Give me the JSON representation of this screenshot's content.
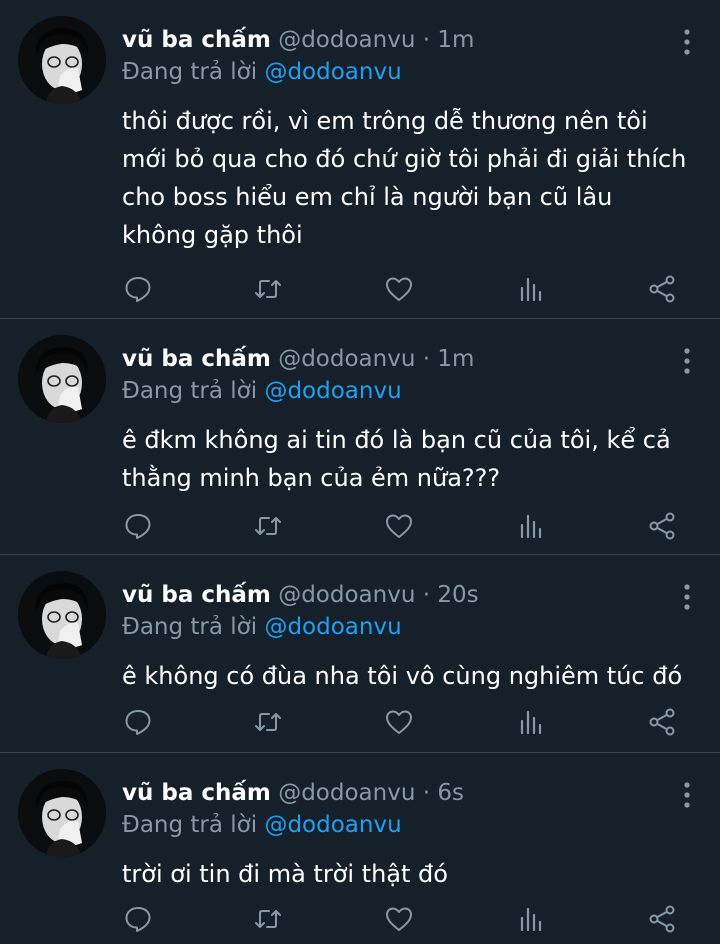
{
  "tweets": [
    {
      "display_name": "vũ ba chấm",
      "handle": "@dodoanvu",
      "separator": "·",
      "time": "1m",
      "reply_prefix": "Đang trả lời",
      "reply_to": "@dodoanvu",
      "text": "thôi được rồi, vì em trông dễ thương nên tôi mới bỏ qua cho đó chứ giờ tôi phải đi giải thích cho boss hiểu em chỉ là người bạn cũ lâu không gặp thôi"
    },
    {
      "display_name": "vũ ba chấm",
      "handle": "@dodoanvu",
      "separator": "·",
      "time": "1m",
      "reply_prefix": "Đang trả lời",
      "reply_to": "@dodoanvu",
      "text": "ê đkm không ai tin đó là bạn cũ của tôi, kể cả thằng minh bạn của ẻm nữa???"
    },
    {
      "display_name": "vũ ba chấm",
      "handle": "@dodoanvu",
      "separator": "·",
      "time": "20s",
      "reply_prefix": "Đang trả lời",
      "reply_to": "@dodoanvu",
      "text": "ê không có đùa nha tôi vô cùng nghiêm túc đó"
    },
    {
      "display_name": "vũ ba chấm",
      "handle": "@dodoanvu",
      "separator": "·",
      "time": "6s",
      "reply_prefix": "Đang trả lời",
      "reply_to": "@dodoanvu",
      "text": "trời ơi tin đi mà trời thật đó"
    }
  ],
  "icons": {
    "more": "more-vertical-icon",
    "reply": "reply-icon",
    "retweet": "retweet-icon",
    "like": "heart-icon",
    "stats": "analytics-icon",
    "share": "share-icon"
  },
  "colors": {
    "background": "#15202b",
    "divider": "#38444d",
    "secondary_text": "#8899a6",
    "mention": "#1da1f2",
    "primary_text": "#ffffff"
  }
}
